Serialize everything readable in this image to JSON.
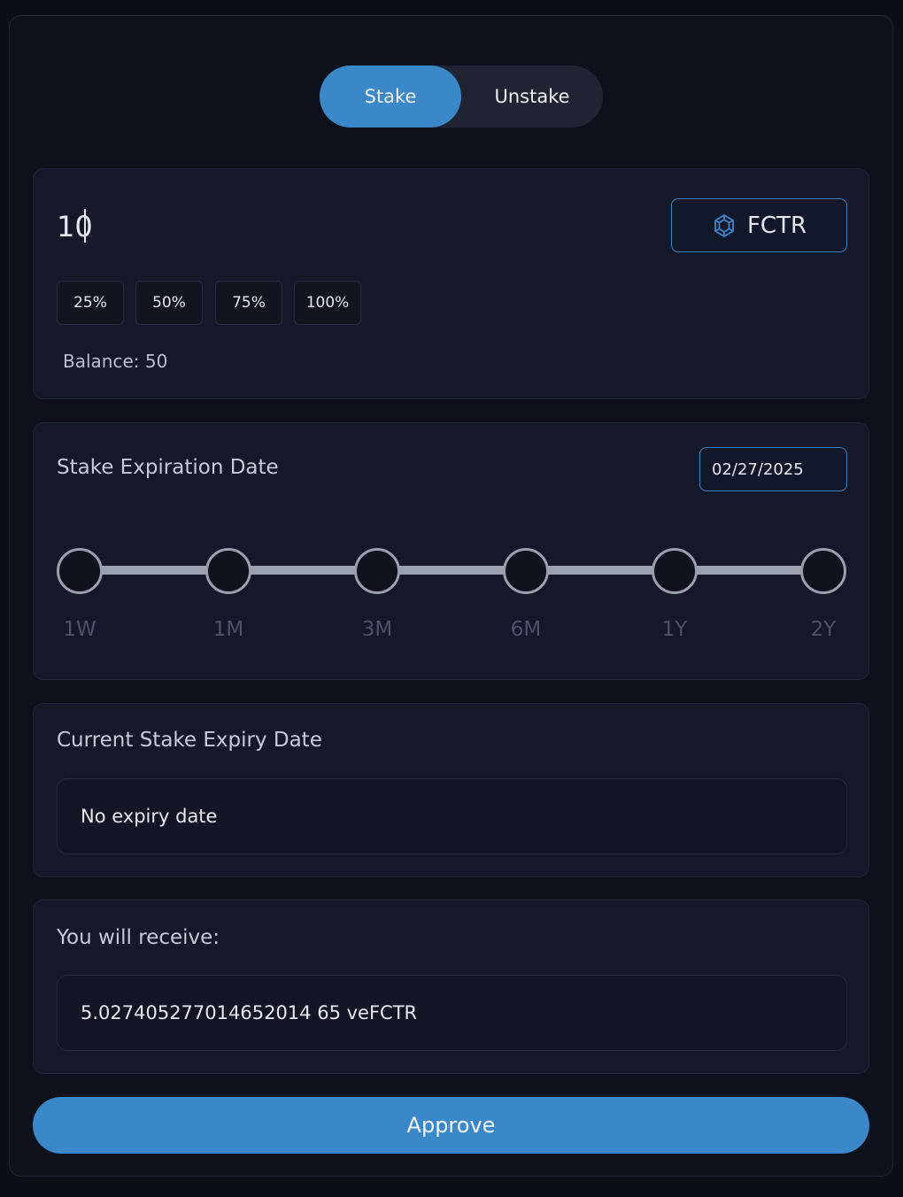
{
  "tabs": {
    "stake_label": "Stake",
    "unstake_label": "Unstake",
    "active": "Stake"
  },
  "amount": {
    "value": "10",
    "token_label": "FCTR",
    "token_icon": "fctr-logo-icon",
    "percent_options": [
      "25%",
      "50%",
      "75%",
      "100%"
    ],
    "balance_text": "Balance: 50"
  },
  "expiration": {
    "title": "Stake Expiration Date",
    "date": "02/27/2025",
    "ticks": [
      "1W",
      "1M",
      "3M",
      "6M",
      "1Y",
      "2Y"
    ]
  },
  "current": {
    "title": "Current Stake Expiry Date",
    "value": "No expiry date"
  },
  "receive": {
    "title": "You will receive:",
    "value": "5.027405277014652014 65 veFCTR"
  },
  "approve_label": "Approve",
  "colors": {
    "accent": "#3a87c9",
    "background": "#0d111b",
    "card": "#131928"
  }
}
